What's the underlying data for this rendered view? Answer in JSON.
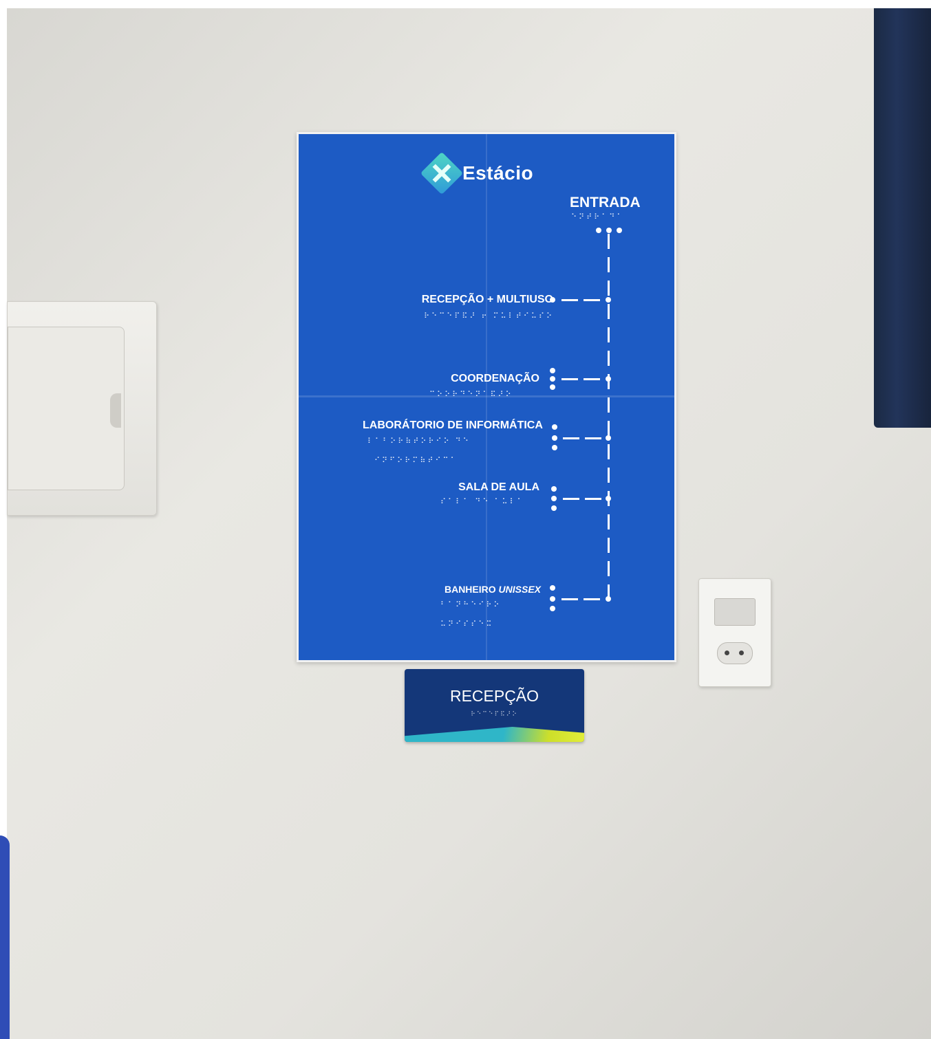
{
  "poster": {
    "logo_text": "Estácio",
    "entrada": "ENTRADA",
    "entrada_braille": "⠑⠝⠞⠗⠁⠙⠁",
    "items": [
      {
        "label": "RECEPÇÃO + MULTIUSO",
        "braille": "⠗⠑⠉⠑⠏⠯⠜ ⠖ ⠍⠥⠇⠞⠊⠥⠎⠕"
      },
      {
        "label": "COORDENAÇÃO",
        "braille": "⠉⠕⠕⠗⠙⠑⠝⠁⠯⠜⠕"
      },
      {
        "label": "LABORÁTORIO DE INFORMÁTICA",
        "braille": "⠇⠁⠃⠕⠗⠷⠞⠕⠗⠊⠕ ⠙⠑",
        "braille2": "⠊⠝⠋⠕⠗⠍⠷⠞⠊⠉⠁"
      },
      {
        "label": "SALA DE AULA",
        "braille": "⠎⠁⠇⠁ ⠙⠑ ⠁⠥⠇⠁"
      },
      {
        "label": "BANHEIRO",
        "label_italic": "UNISSEX",
        "braille": "⠃⠁⠝⠓⠑⠊⠗⠕",
        "braille2": "⠥⠝⠊⠎⠎⠑⠭"
      }
    ],
    "colors": {
      "background": "#1d5bc4",
      "text": "#ffffff"
    }
  },
  "door_sign": {
    "title": "RECEPÇÃO",
    "braille": "⠗⠑⠉⠑⠏⠯⠜⠕",
    "colors": {
      "background": "#143779",
      "band_start": "#2fb6c8",
      "band_end": "#e1ec3a"
    }
  }
}
